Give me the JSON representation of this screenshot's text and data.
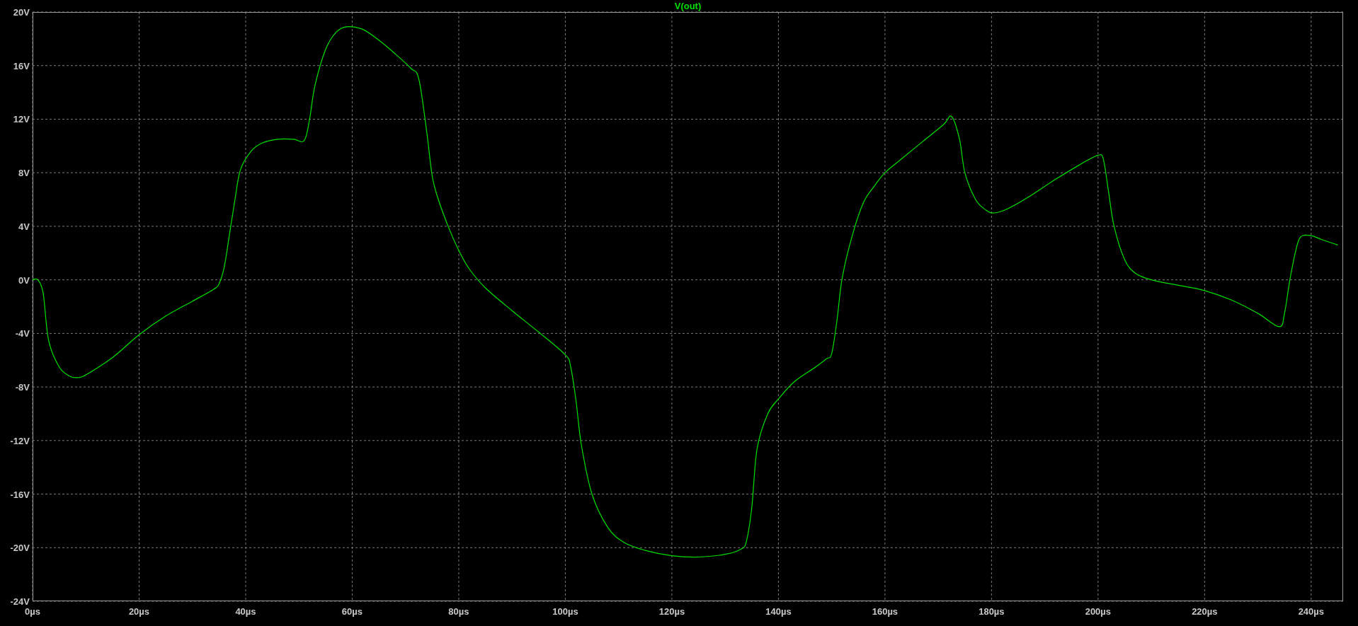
{
  "plot": {
    "chart_data": {
      "type": "line",
      "grid": true,
      "x": [
        0,
        1,
        2,
        3,
        5,
        7,
        8.5,
        10,
        15,
        20,
        25,
        30,
        34,
        35,
        36,
        37,
        38,
        39,
        41,
        43,
        46,
        49,
        51,
        52,
        53,
        55,
        57,
        59,
        62,
        65,
        68,
        71,
        72.5,
        74,
        75,
        76,
        78,
        80,
        82,
        85,
        90,
        95,
        100,
        101,
        102,
        103,
        105,
        108,
        111,
        115,
        120,
        125,
        130,
        133,
        134,
        135,
        136,
        138,
        140,
        143,
        147,
        149,
        150,
        151,
        152,
        154,
        156,
        158,
        160,
        163,
        167,
        171,
        172.5,
        174,
        175,
        177,
        179,
        180.5,
        183,
        187,
        192,
        197,
        200,
        201,
        202,
        203,
        205,
        207,
        210,
        215,
        220,
        225,
        230,
        234,
        235,
        236,
        237,
        238,
        240,
        242,
        245
      ],
      "series": [
        {
          "name": "V(out)",
          "color": "#00e000",
          "values": [
            0,
            0,
            -1,
            -4.5,
            -6.5,
            -7.2,
            -7.3,
            -7.1,
            -5.8,
            -4.1,
            -2.7,
            -1.6,
            -0.7,
            -0.3,
            1,
            3.5,
            6,
            8.2,
            9.6,
            10.2,
            10.5,
            10.5,
            10.4,
            12,
            14.5,
            17.2,
            18.5,
            18.9,
            18.7,
            17.9,
            16.9,
            15.8,
            15,
            11,
            7.8,
            6.2,
            4,
            2.2,
            0.8,
            -0.6,
            -2.3,
            -3.9,
            -5.6,
            -6.5,
            -9,
            -12.3,
            -16,
            -18.5,
            -19.6,
            -20.2,
            -20.6,
            -20.7,
            -20.5,
            -20.1,
            -19.5,
            -17,
            -12.6,
            -10,
            -8.9,
            -7.6,
            -6.5,
            -5.9,
            -5.5,
            -3,
            0.2,
            3.5,
            5.8,
            7,
            8,
            9,
            10.3,
            11.6,
            12.2,
            10.5,
            8,
            6,
            5.2,
            5,
            5.3,
            6.2,
            7.5,
            8.7,
            9.3,
            9,
            6.5,
            4,
            1.5,
            0.5,
            0,
            -0.4,
            -0.8,
            -1.5,
            -2.5,
            -3.5,
            -2.5,
            0,
            2,
            3.2,
            3.3,
            3,
            2.6
          ]
        }
      ],
      "xlim": [
        0,
        246
      ],
      "ylim": [
        -24,
        20
      ],
      "xticks": [
        {
          "value": 0,
          "label": "0µs"
        },
        {
          "value": 20,
          "label": "20µs"
        },
        {
          "value": 40,
          "label": "40µs"
        },
        {
          "value": 60,
          "label": "60µs"
        },
        {
          "value": 80,
          "label": "80µs"
        },
        {
          "value": 100,
          "label": "100µs"
        },
        {
          "value": 120,
          "label": "120µs"
        },
        {
          "value": 140,
          "label": "140µs"
        },
        {
          "value": 160,
          "label": "160µs"
        },
        {
          "value": 180,
          "label": "180µs"
        },
        {
          "value": 200,
          "label": "200µs"
        },
        {
          "value": 220,
          "label": "220µs"
        },
        {
          "value": 240,
          "label": "240µs"
        }
      ],
      "yticks": [
        {
          "value": 20,
          "label": "20V"
        },
        {
          "value": 16,
          "label": "16V"
        },
        {
          "value": 12,
          "label": "12V"
        },
        {
          "value": 8,
          "label": "8V"
        },
        {
          "value": 4,
          "label": "4V"
        },
        {
          "value": 0,
          "label": "0V"
        },
        {
          "value": -4,
          "label": "-4V"
        },
        {
          "value": -8,
          "label": "-8V"
        },
        {
          "value": -12,
          "label": "-12V"
        },
        {
          "value": -16,
          "label": "-16V"
        },
        {
          "value": -20,
          "label": "-20V"
        },
        {
          "value": -24,
          "label": "-24V"
        }
      ]
    }
  }
}
